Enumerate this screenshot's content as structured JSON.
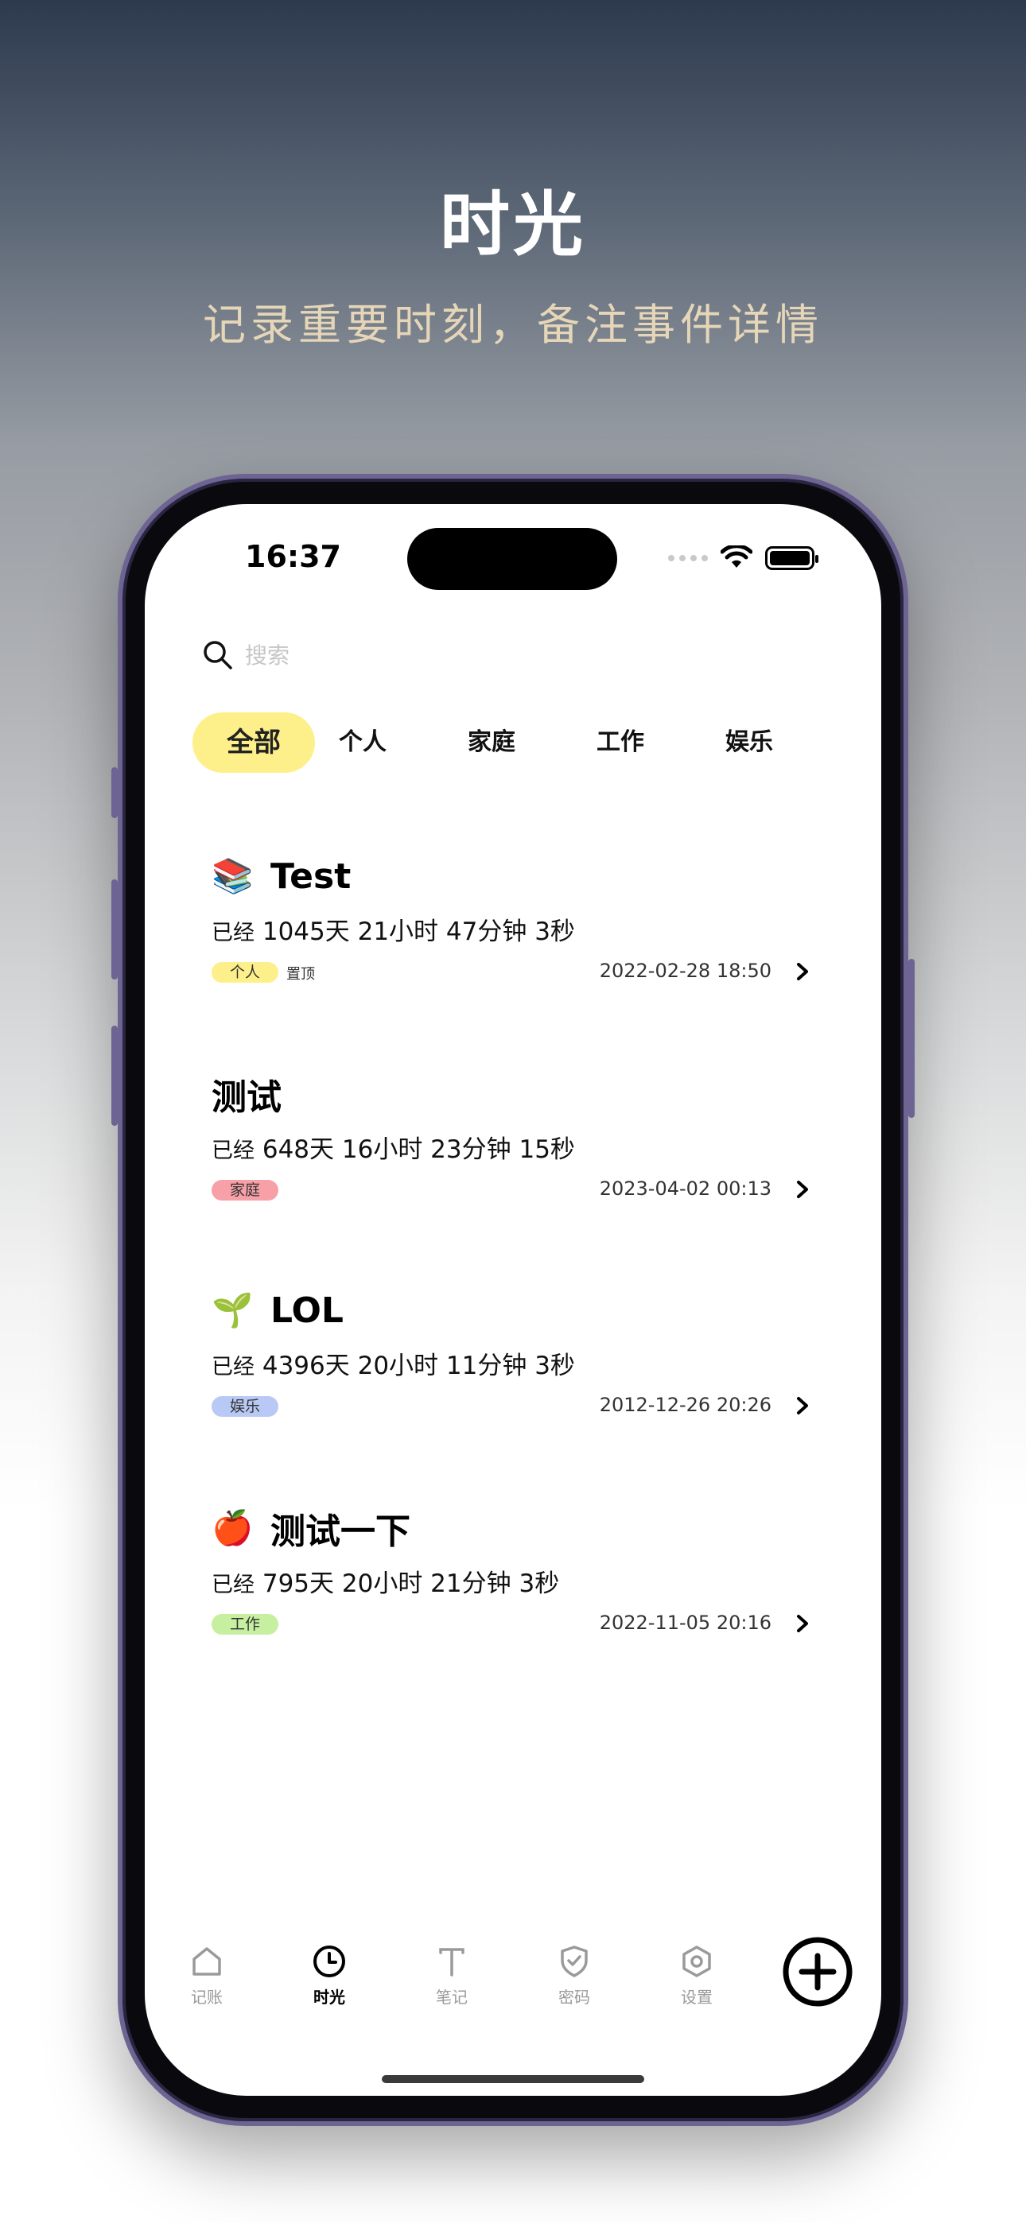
{
  "promo": {
    "title": "时光",
    "subtitle": "记录重要时刻，备注事件详情"
  },
  "status_bar": {
    "time": "16:37",
    "icons": [
      "signal-dots-icon",
      "wifi-icon",
      "battery-icon"
    ]
  },
  "search": {
    "placeholder": "搜索"
  },
  "categories": [
    {
      "label": "全部",
      "active": true
    },
    {
      "label": "个人",
      "active": false
    },
    {
      "label": "家庭",
      "active": false
    },
    {
      "label": "工作",
      "active": false
    },
    {
      "label": "娱乐",
      "active": false
    }
  ],
  "events": [
    {
      "emoji": "📚",
      "emoji_icon": "books-icon",
      "title": "Test",
      "prefix": "已经",
      "duration": "1045天 21小时 47分钟 3秒",
      "tag": "个人",
      "tag_color": "#fdf08a",
      "pinned_label": "置顶",
      "date": "2022-02-28 18:50"
    },
    {
      "emoji": "",
      "emoji_icon": "",
      "title": "测试",
      "prefix": "已经",
      "duration": "648天 16小时 23分钟 15秒",
      "tag": "家庭",
      "tag_color": "#f7a0a8",
      "pinned_label": "",
      "date": "2023-04-02 00:13"
    },
    {
      "emoji": "🌱",
      "emoji_icon": "seedling-icon",
      "title": "LOL",
      "prefix": "已经",
      "duration": "4396天 20小时 11分钟 3秒",
      "tag": "娱乐",
      "tag_color": "#b9c9f5",
      "pinned_label": "",
      "date": "2012-12-26 20:26"
    },
    {
      "emoji": "🍎",
      "emoji_icon": "apple-icon",
      "title": "测试一下",
      "prefix": "已经",
      "duration": "795天 20小时 21分钟 3秒",
      "tag": "工作",
      "tag_color": "#c6f0a0",
      "pinned_label": "",
      "date": "2022-11-05 20:16"
    }
  ],
  "tabbar": {
    "items": [
      {
        "label": "记账",
        "icon": "home-icon",
        "active": false
      },
      {
        "label": "时光",
        "icon": "clock-icon",
        "active": true
      },
      {
        "label": "笔记",
        "icon": "text-icon",
        "active": false
      },
      {
        "label": "密码",
        "icon": "shield-check-icon",
        "active": false
      },
      {
        "label": "设置",
        "icon": "settings-hexagon-icon",
        "active": false
      }
    ],
    "add_icon": "plus-circle-icon"
  },
  "colors": {
    "accent_yellow": "#fdf08a",
    "subtitle_gold": "#e6d6b8",
    "frame_purple": "#6d6494"
  }
}
